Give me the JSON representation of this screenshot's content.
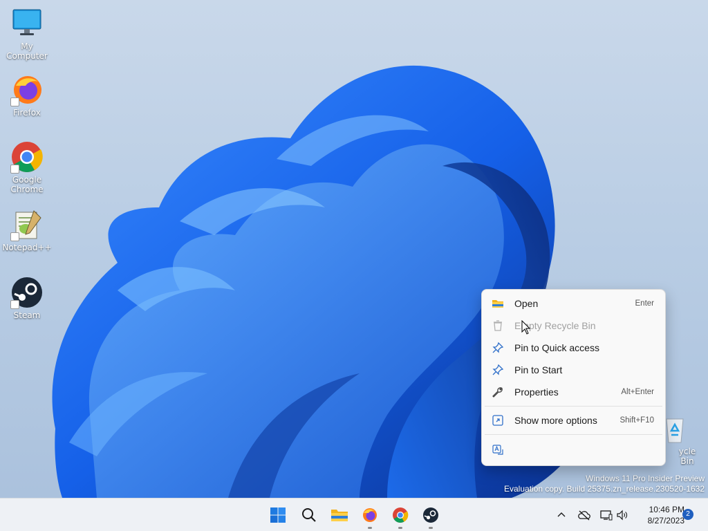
{
  "desktop": {
    "icons": [
      {
        "label": "My Computer",
        "icon": "monitor-icon",
        "shortcut": false
      },
      {
        "label": "Firefox",
        "icon": "firefox-icon",
        "shortcut": true
      },
      {
        "label": "Google Chrome",
        "icon": "chrome-icon",
        "shortcut": true
      },
      {
        "label": "Notepad++",
        "icon": "notepadpp-icon",
        "shortcut": true
      },
      {
        "label": "Steam",
        "icon": "steam-icon",
        "shortcut": true
      },
      {
        "label": "ycle Bin",
        "icon": "recycle-bin-icon",
        "shortcut": false
      }
    ]
  },
  "context_menu": {
    "items": [
      {
        "label": "Open",
        "shortcut": "Enter",
        "icon": "folder-icon",
        "enabled": true
      },
      {
        "label": "Empty Recycle Bin",
        "shortcut": "",
        "icon": "trash-icon",
        "enabled": false
      },
      {
        "label": "Pin to Quick access",
        "shortcut": "",
        "icon": "pin-icon",
        "enabled": true
      },
      {
        "label": "Pin to Start",
        "shortcut": "",
        "icon": "pin-icon",
        "enabled": true
      },
      {
        "label": "Properties",
        "shortcut": "Alt+Enter",
        "icon": "wrench-icon",
        "enabled": true
      },
      {
        "label": "Show more options",
        "shortcut": "Shift+F10",
        "icon": "expand-icon",
        "enabled": true
      }
    ],
    "footer_icon": "translate-icon"
  },
  "watermark": {
    "line1": "Windows 11 Pro Insider Preview",
    "line2": "Evaluation copy. Build 25375.zn_release.230520-1632"
  },
  "taskbar": {
    "apps": [
      "start-icon",
      "search-icon",
      "file-explorer-icon",
      "firefox-icon",
      "chrome-icon",
      "steam-icon"
    ],
    "tray": [
      "chevron-up-icon",
      "cloud-off-icon",
      "network-icon",
      "volume-icon"
    ],
    "time": "10:46 PM",
    "date": "8/27/2023",
    "notifications": "2"
  },
  "colors": {
    "accent": "#1f5fbf",
    "bloom": "#1a6ef0",
    "menu_bg": "#f9f9f9",
    "taskbar_bg": "#eef1f5"
  }
}
